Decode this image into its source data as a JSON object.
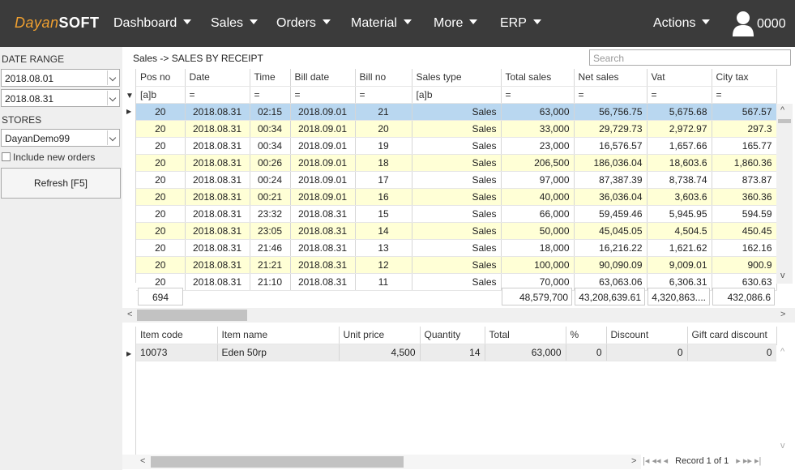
{
  "app": {
    "logo_a": "Dayan",
    "logo_b": "SOFT",
    "user_code": "0000"
  },
  "nav": {
    "dashboard": "Dashboard",
    "sales": "Sales",
    "orders": "Orders",
    "material": "Material",
    "more": "More",
    "erp": "ERP",
    "actions": "Actions"
  },
  "left": {
    "date_range_label": "DATE RANGE",
    "date_from": "2018.08.01",
    "date_to": "2018.08.31",
    "stores_label": "STORES",
    "store": "DayanDemo99",
    "include_new_orders": "Include new orders",
    "refresh": "Refresh [F5]"
  },
  "breadcrumb": "Sales -> SALES BY RECEIPT",
  "search": {
    "placeholder": "Search"
  },
  "sales_grid": {
    "columns": [
      "Pos no",
      "Date",
      "Time",
      "Bill date",
      "Bill no",
      "Sales type",
      "Total sales",
      "Net sales",
      "Vat",
      "City tax"
    ],
    "filters": [
      "[a]b",
      "=",
      "=",
      "=",
      "=",
      "[a]b",
      "=",
      "=",
      "=",
      "="
    ],
    "rows": [
      [
        "20",
        "2018.08.31",
        "02:15",
        "2018.09.01",
        "21",
        "Sales",
        "63,000",
        "56,756.75",
        "5,675.68",
        "567.57"
      ],
      [
        "20",
        "2018.08.31",
        "00:34",
        "2018.09.01",
        "20",
        "Sales",
        "33,000",
        "29,729.73",
        "2,972.97",
        "297.3"
      ],
      [
        "20",
        "2018.08.31",
        "00:34",
        "2018.09.01",
        "19",
        "Sales",
        "23,000",
        "16,576.57",
        "1,657.66",
        "165.77"
      ],
      [
        "20",
        "2018.08.31",
        "00:26",
        "2018.09.01",
        "18",
        "Sales",
        "206,500",
        "186,036.04",
        "18,603.6",
        "1,860.36"
      ],
      [
        "20",
        "2018.08.31",
        "00:24",
        "2018.09.01",
        "17",
        "Sales",
        "97,000",
        "87,387.39",
        "8,738.74",
        "873.87"
      ],
      [
        "20",
        "2018.08.31",
        "00:21",
        "2018.09.01",
        "16",
        "Sales",
        "40,000",
        "36,036.04",
        "3,603.6",
        "360.36"
      ],
      [
        "20",
        "2018.08.31",
        "23:32",
        "2018.08.31",
        "15",
        "Sales",
        "66,000",
        "59,459.46",
        "5,945.95",
        "594.59"
      ],
      [
        "20",
        "2018.08.31",
        "23:05",
        "2018.08.31",
        "14",
        "Sales",
        "50,000",
        "45,045.05",
        "4,504.5",
        "450.45"
      ],
      [
        "20",
        "2018.08.31",
        "21:46",
        "2018.08.31",
        "13",
        "Sales",
        "18,000",
        "16,216.22",
        "1,621.62",
        "162.16"
      ],
      [
        "20",
        "2018.08.31",
        "21:21",
        "2018.08.31",
        "12",
        "Sales",
        "100,000",
        "90,090.09",
        "9,009.01",
        "900.9"
      ],
      [
        "20",
        "2018.08.31",
        "21:10",
        "2018.08.31",
        "11",
        "Sales",
        "70,000",
        "63,063.06",
        "6,306.31",
        "630.63"
      ]
    ],
    "totals": {
      "count": "694",
      "total_sales": "48,579,700",
      "net_sales": "43,208,639.61",
      "vat": "4,320,863....",
      "city_tax": "432,086.6"
    }
  },
  "detail_grid": {
    "columns": [
      "Item code",
      "Item name",
      "Unit price",
      "Quantity",
      "Total",
      "%",
      "Discount",
      "Gift card discount"
    ],
    "rows": [
      [
        "10073",
        "Eden 50rp",
        "4,500",
        "14",
        "63,000",
        "0",
        "0",
        "0"
      ]
    ]
  },
  "pager": {
    "record_text": "Record 1 of 1"
  },
  "colors": {
    "topbar": "#3b3b3b",
    "accent": "#f0a030",
    "row_alt": "#ffffd6",
    "row_selected": "#b9d7f0"
  }
}
